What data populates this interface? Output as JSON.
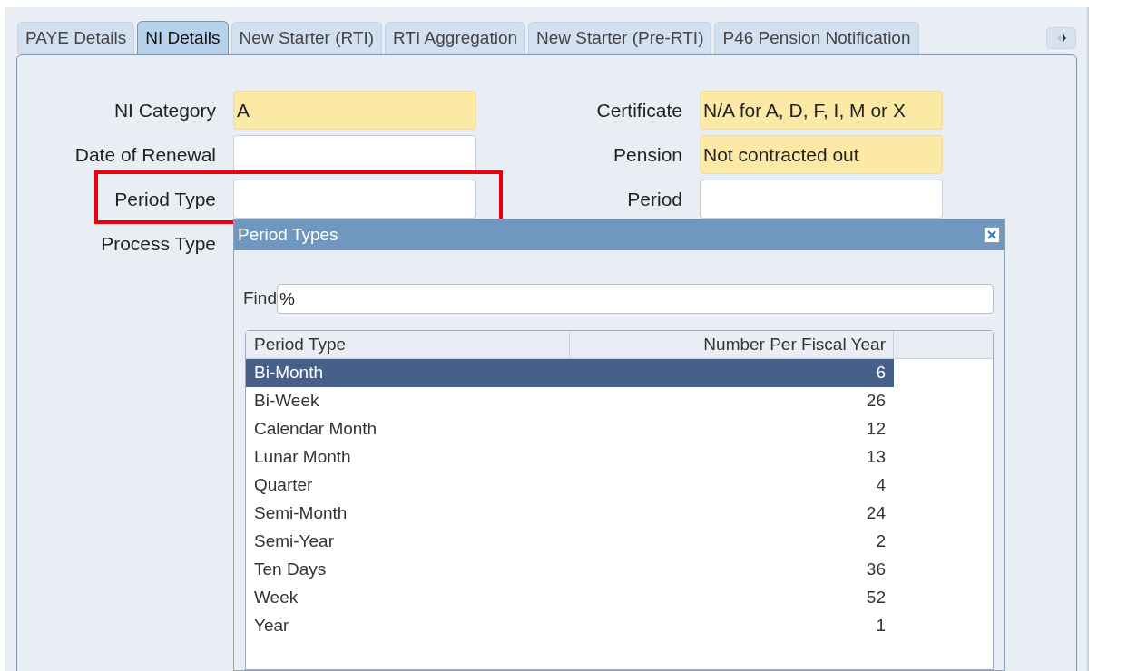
{
  "tabs": [
    {
      "label": "PAYE Details",
      "selected": false
    },
    {
      "label": "NI Details",
      "selected": true
    },
    {
      "label": "New Starter (RTI)",
      "selected": false
    },
    {
      "label": "RTI Aggregation",
      "selected": false
    },
    {
      "label": "New Starter (Pre-RTI)",
      "selected": false
    },
    {
      "label": "P46 Pension Notification",
      "selected": false
    }
  ],
  "form": {
    "left": [
      {
        "label": "NI Category",
        "value": "A",
        "required": true
      },
      {
        "label": "Date of Renewal",
        "required": false
      },
      {
        "label": "Period Type",
        "required": false,
        "highlighted": true
      },
      {
        "label": "Process Type"
      }
    ],
    "right": [
      {
        "label": "Certificate",
        "value": "N/A for A, D, F, I, M or X",
        "required": true
      },
      {
        "label": "Pension",
        "value": "Not contracted out",
        "required": true
      },
      {
        "label": "Period",
        "required": false
      }
    ]
  },
  "dialog": {
    "title": "Period Types",
    "find_label": "Find",
    "find_value": "%",
    "columns": [
      "Period Type",
      "Number Per Fiscal Year"
    ],
    "rows": [
      {
        "cells": [
          "Bi-Month",
          "6"
        ],
        "selected": true
      },
      {
        "cells": [
          "Bi-Week",
          "26"
        ],
        "selected": false
      },
      {
        "cells": [
          "Calendar Month",
          "12"
        ],
        "selected": false
      },
      {
        "cells": [
          "Lunar Month",
          "13"
        ],
        "selected": false
      },
      {
        "cells": [
          "Quarter",
          "4"
        ],
        "selected": false
      },
      {
        "cells": [
          "Semi-Month",
          "24"
        ],
        "selected": false
      },
      {
        "cells": [
          "Semi-Year",
          "2"
        ],
        "selected": false
      },
      {
        "cells": [
          "Ten Days",
          "36"
        ],
        "selected": false
      },
      {
        "cells": [
          "Week",
          "52"
        ],
        "selected": false
      },
      {
        "cells": [
          "Year",
          "1"
        ],
        "selected": false
      }
    ]
  }
}
